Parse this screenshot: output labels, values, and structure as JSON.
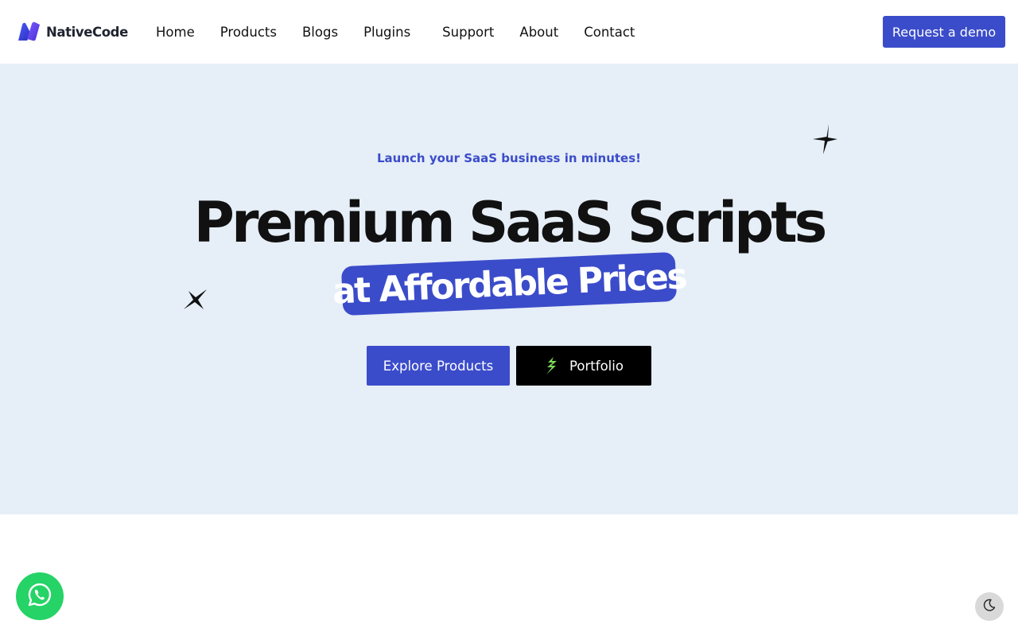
{
  "header": {
    "logo_text": "NativeCode",
    "logo_icon": "native-code-logo-icon",
    "nav": {
      "home": "Home",
      "products": "Products",
      "blogs": "Blogs",
      "plugins": "Plugins",
      "support": "Support",
      "about": "About",
      "contact": "Contact"
    },
    "cta_label": "Request a demo"
  },
  "hero": {
    "tagline": "Launch your SaaS business in minutes!",
    "headline": "Premium SaaS Scripts",
    "highlight": "at Affordable Prices",
    "buttons": {
      "explore": "Explore Products",
      "portfolio": "Portfolio"
    },
    "decor_icons": [
      "sparkle-icon",
      "sparkle-icon"
    ]
  },
  "widgets": {
    "whatsapp_icon": "whatsapp-icon",
    "theme_icon": "moon-icon"
  },
  "colors": {
    "brand": "#3b4cca",
    "hero_bg": "#e6eef7",
    "whatsapp": "#25d366",
    "dark": "#000000"
  }
}
